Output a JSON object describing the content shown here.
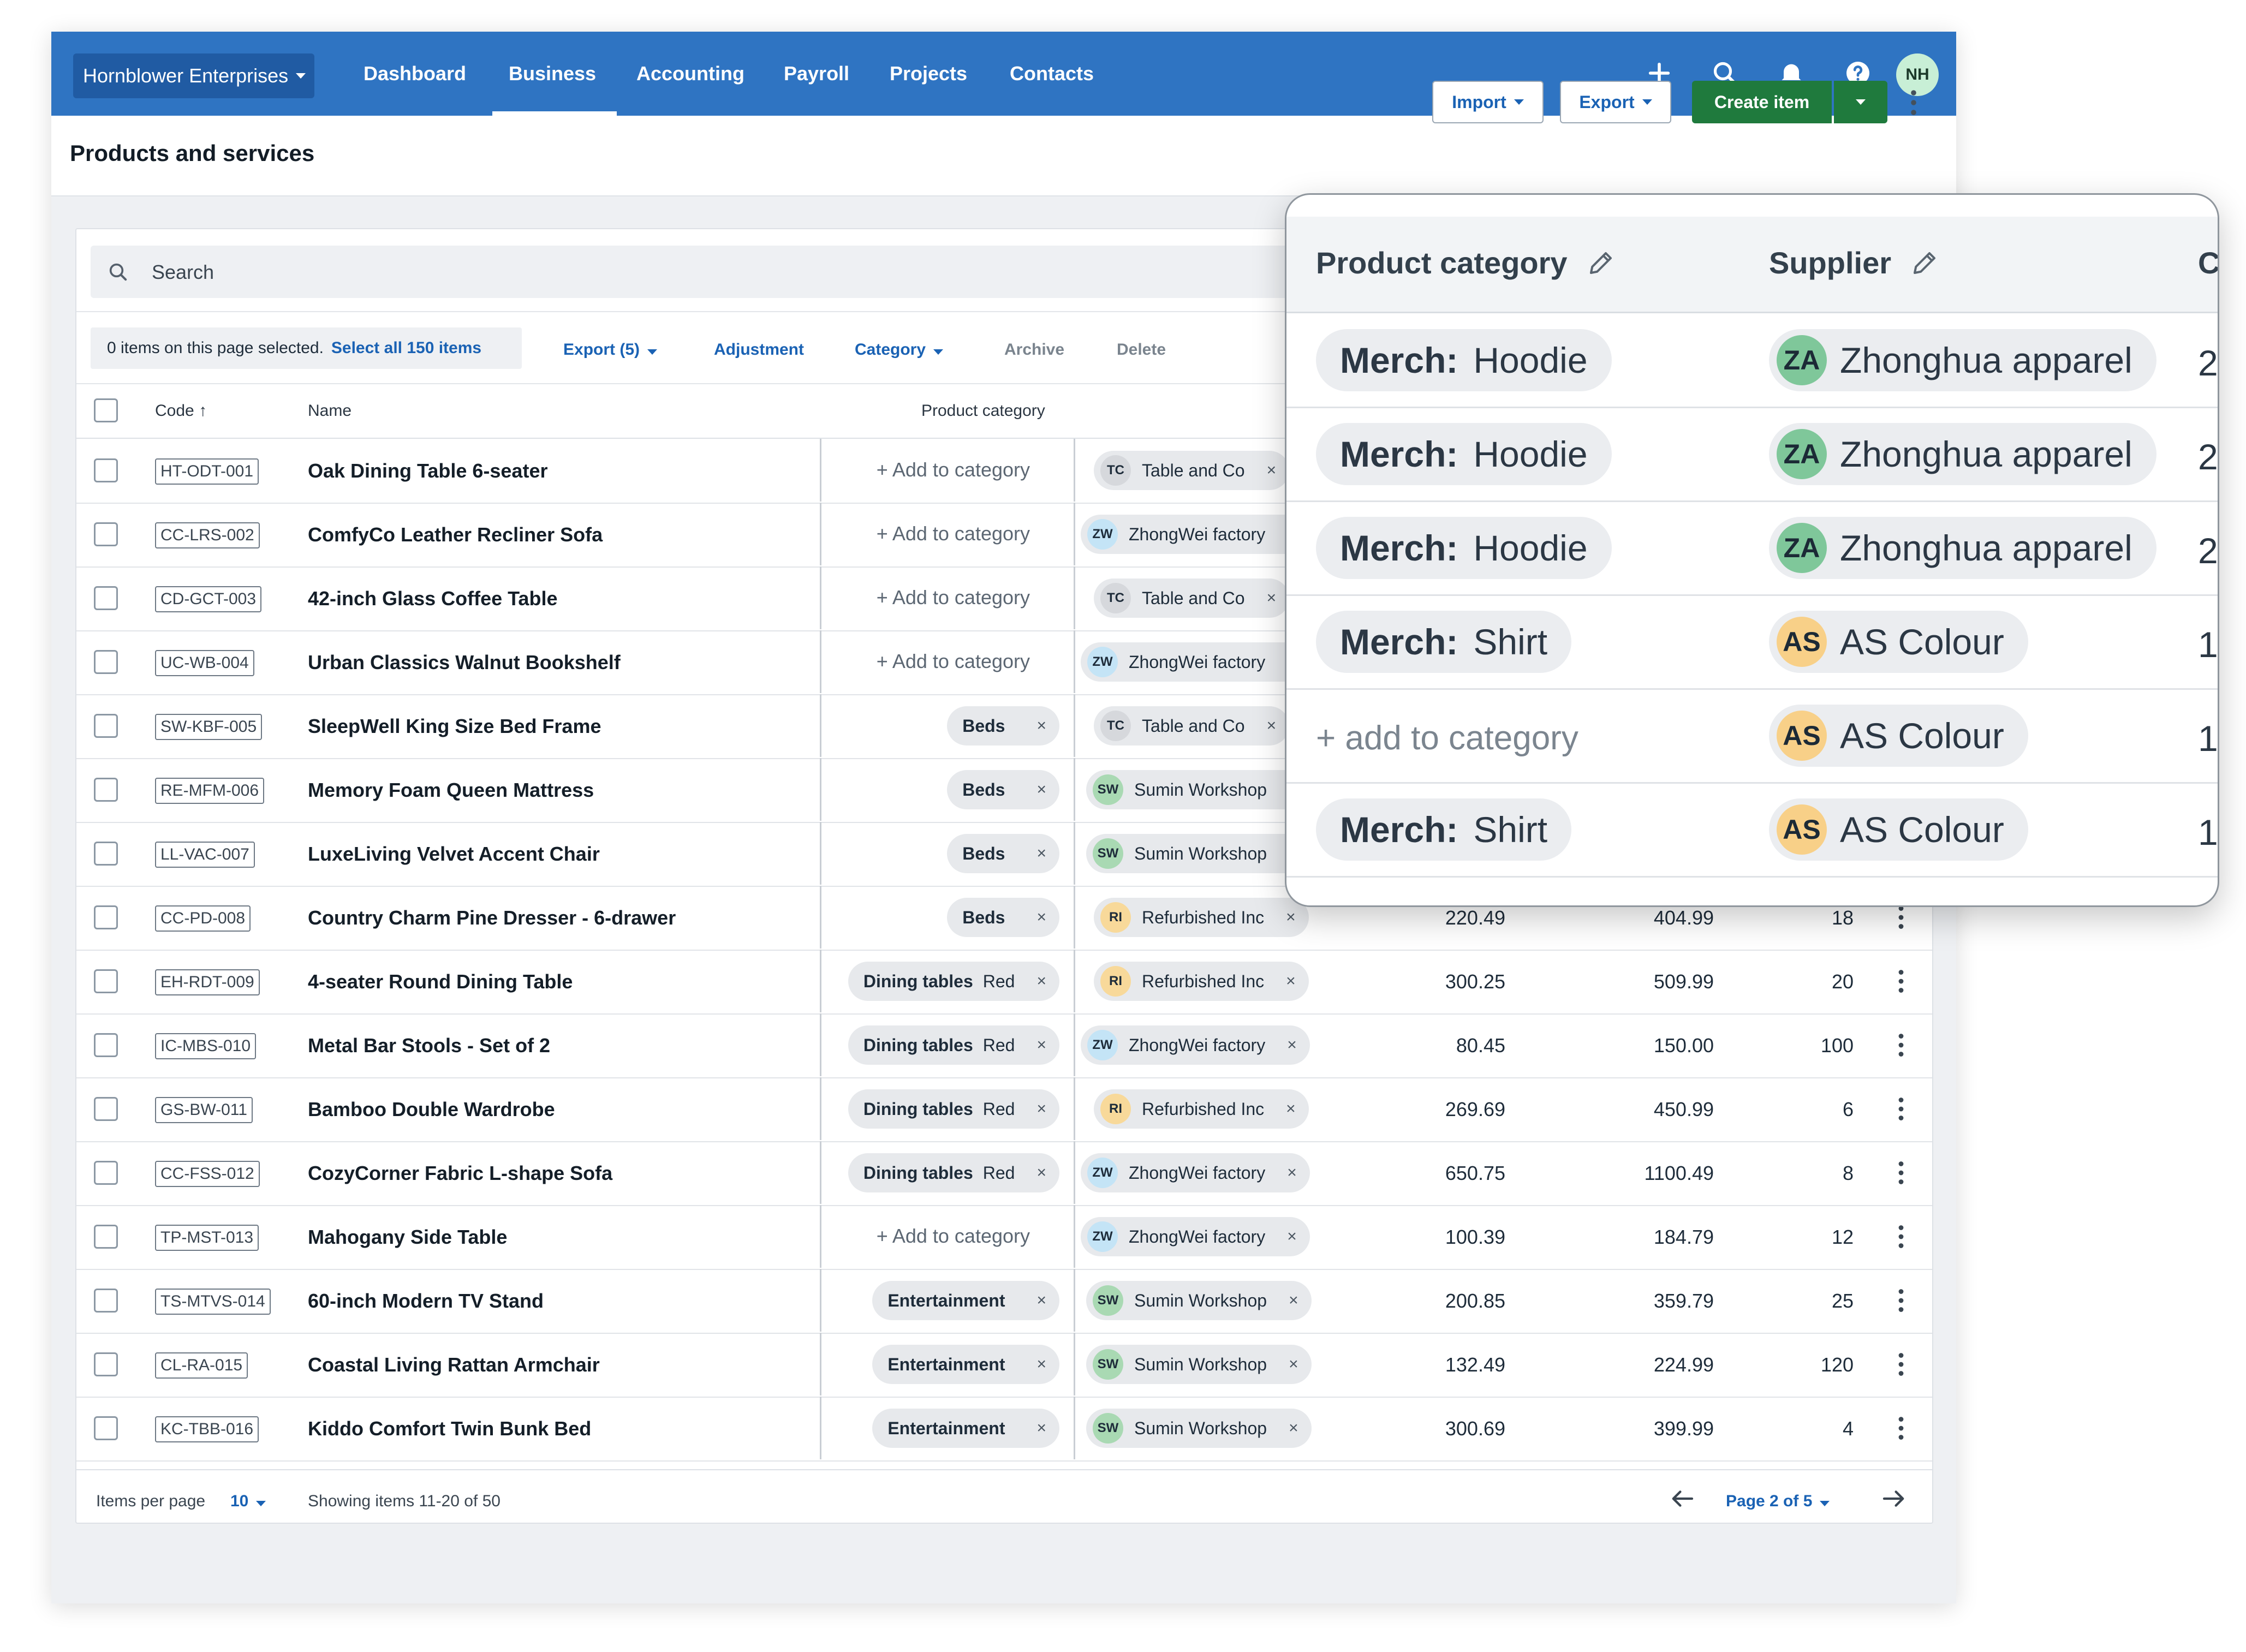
{
  "nav": {
    "org": "Hornblower Enterprises",
    "items": [
      "Dashboard",
      "Business",
      "Accounting",
      "Payroll",
      "Projects",
      "Contacts"
    ],
    "avatar": "NH"
  },
  "header": {
    "title": "Products and services",
    "import_label": "Import",
    "export_label": "Export",
    "create_label": "Create item"
  },
  "search": {
    "placeholder": "Search"
  },
  "bulk": {
    "selected_text": "0 items on this page selected.",
    "select_all": "Select all 150 items",
    "export": "Export (5)",
    "adjustment": "Adjustment",
    "category": "Category",
    "archive": "Archive",
    "delete": "Delete"
  },
  "columns": {
    "code": "Code",
    "name": "Name",
    "category": "Product category",
    "supplier": "Su"
  },
  "add_category_label": "+ Add to category",
  "rows": [
    {
      "code": "HT-ODT-001",
      "name": "Oak Dining Table 6-seater",
      "cat": "",
      "cat2": "",
      "sup_init": "TC",
      "sup": "Table and Co",
      "c1": "",
      "c2": "",
      "c3": ""
    },
    {
      "code": "CC-LRS-002",
      "name": "ComfyCo Leather Recliner Sofa",
      "cat": "",
      "cat2": "",
      "sup_init": "ZW",
      "sup": "ZhongWei factory",
      "c1": "",
      "c2": "",
      "c3": ""
    },
    {
      "code": "CD-GCT-003",
      "name": "42-inch Glass Coffee Table",
      "cat": "",
      "cat2": "",
      "sup_init": "TC",
      "sup": "Table and Co",
      "c1": "",
      "c2": "",
      "c3": ""
    },
    {
      "code": "UC-WB-004",
      "name": "Urban Classics Walnut Bookshelf",
      "cat": "",
      "cat2": "",
      "sup_init": "ZW",
      "sup": "ZhongWei factory",
      "c1": "",
      "c2": "",
      "c3": ""
    },
    {
      "code": "SW-KBF-005",
      "name": "SleepWell King Size Bed Frame",
      "cat": "Beds",
      "cat2": "",
      "sup_init": "TC",
      "sup": "Table and Co",
      "c1": "",
      "c2": "",
      "c3": ""
    },
    {
      "code": "RE-MFM-006",
      "name": "Memory Foam Queen Mattress",
      "cat": "Beds",
      "cat2": "",
      "sup_init": "SW",
      "sup": "Sumin Workshop",
      "c1": "",
      "c2": "",
      "c3": ""
    },
    {
      "code": "LL-VAC-007",
      "name": "LuxeLiving Velvet Accent Chair",
      "cat": "Beds",
      "cat2": "",
      "sup_init": "SW",
      "sup": "Sumin Workshop",
      "c1": "",
      "c2": "",
      "c3": ""
    },
    {
      "code": "CC-PD-008",
      "name": "Country Charm Pine Dresser - 6-drawer",
      "cat": "Beds",
      "cat2": "",
      "sup_init": "RI",
      "sup": "Refurbished Inc",
      "c1": "220.49",
      "c2": "404.99",
      "c3": "18"
    },
    {
      "code": "EH-RDT-009",
      "name": "4-seater Round Dining Table",
      "cat": "Dining tables",
      "cat2": "Red",
      "sup_init": "RI",
      "sup": "Refurbished Inc",
      "c1": "300.25",
      "c2": "509.99",
      "c3": "20"
    },
    {
      "code": "IC-MBS-010",
      "name": "Metal Bar Stools - Set of 2",
      "cat": "Dining tables",
      "cat2": "Red",
      "sup_init": "ZW",
      "sup": "ZhongWei factory",
      "c1": "80.45",
      "c2": "150.00",
      "c3": "100"
    },
    {
      "code": "GS-BW-011",
      "name": "Bamboo Double Wardrobe",
      "cat": "Dining tables",
      "cat2": "Red",
      "sup_init": "RI",
      "sup": "Refurbished Inc",
      "c1": "269.69",
      "c2": "450.99",
      "c3": "6"
    },
    {
      "code": "CC-FSS-012",
      "name": "CozyCorner Fabric L-shape Sofa",
      "cat": "Dining tables",
      "cat2": "Red",
      "sup_init": "ZW",
      "sup": "ZhongWei factory",
      "c1": "650.75",
      "c2": "1100.49",
      "c3": "8"
    },
    {
      "code": "TP-MST-013",
      "name": "Mahogany Side Table",
      "cat": "",
      "cat2": "",
      "sup_init": "ZW",
      "sup": "ZhongWei factory",
      "c1": "100.39",
      "c2": "184.79",
      "c3": "12"
    },
    {
      "code": "TS-MTVS-014",
      "name": "60-inch Modern TV Stand",
      "cat": "Entertainment",
      "cat2": "",
      "sup_init": "SW",
      "sup": "Sumin Workshop",
      "c1": "200.85",
      "c2": "359.79",
      "c3": "25"
    },
    {
      "code": "CL-RA-015",
      "name": "Coastal Living Rattan Armchair",
      "cat": "Entertainment",
      "cat2": "",
      "sup_init": "SW",
      "sup": "Sumin Workshop",
      "c1": "132.49",
      "c2": "224.99",
      "c3": "120"
    },
    {
      "code": "KC-TBB-016",
      "name": "Kiddo Comfort Twin Bunk Bed",
      "cat": "Entertainment",
      "cat2": "",
      "sup_init": "SW",
      "sup": "Sumin Workshop",
      "c1": "300.69",
      "c2": "399.99",
      "c3": "4"
    }
  ],
  "supplier_colors": {
    "TC": "#d6d8dc",
    "ZW": "#c4e4f6",
    "SW": "#a9d9b3",
    "RI": "#f8d99a",
    "ZA": "#7fc79a",
    "AS": "#f8d088"
  },
  "footer": {
    "items_per_page_label": "Items per page",
    "items_per_page": "10",
    "showing": "Showing items 11-20 of 50",
    "page": "Page 2 of 5"
  },
  "zoom": {
    "col_category": "Product category",
    "col_supplier": "Supplier",
    "col_edge": "C",
    "add_label": "+ add to category",
    "rows": [
      {
        "prefix": "Merch:",
        "value": "Hoodie",
        "sup_init": "ZA",
        "sup": "Zhonghua apparel",
        "edge": "2"
      },
      {
        "prefix": "Merch:",
        "value": "Hoodie",
        "sup_init": "ZA",
        "sup": "Zhonghua apparel",
        "edge": "2"
      },
      {
        "prefix": "Merch:",
        "value": "Hoodie",
        "sup_init": "ZA",
        "sup": "Zhonghua apparel",
        "edge": "2"
      },
      {
        "prefix": "Merch:",
        "value": "Shirt",
        "sup_init": "AS",
        "sup": "AS Colour",
        "edge": "1"
      },
      {
        "prefix": "",
        "value": "",
        "sup_init": "AS",
        "sup": "AS Colour",
        "edge": "1"
      },
      {
        "prefix": "Merch:",
        "value": "Shirt",
        "sup_init": "AS",
        "sup": "AS Colour",
        "edge": "1"
      }
    ]
  }
}
